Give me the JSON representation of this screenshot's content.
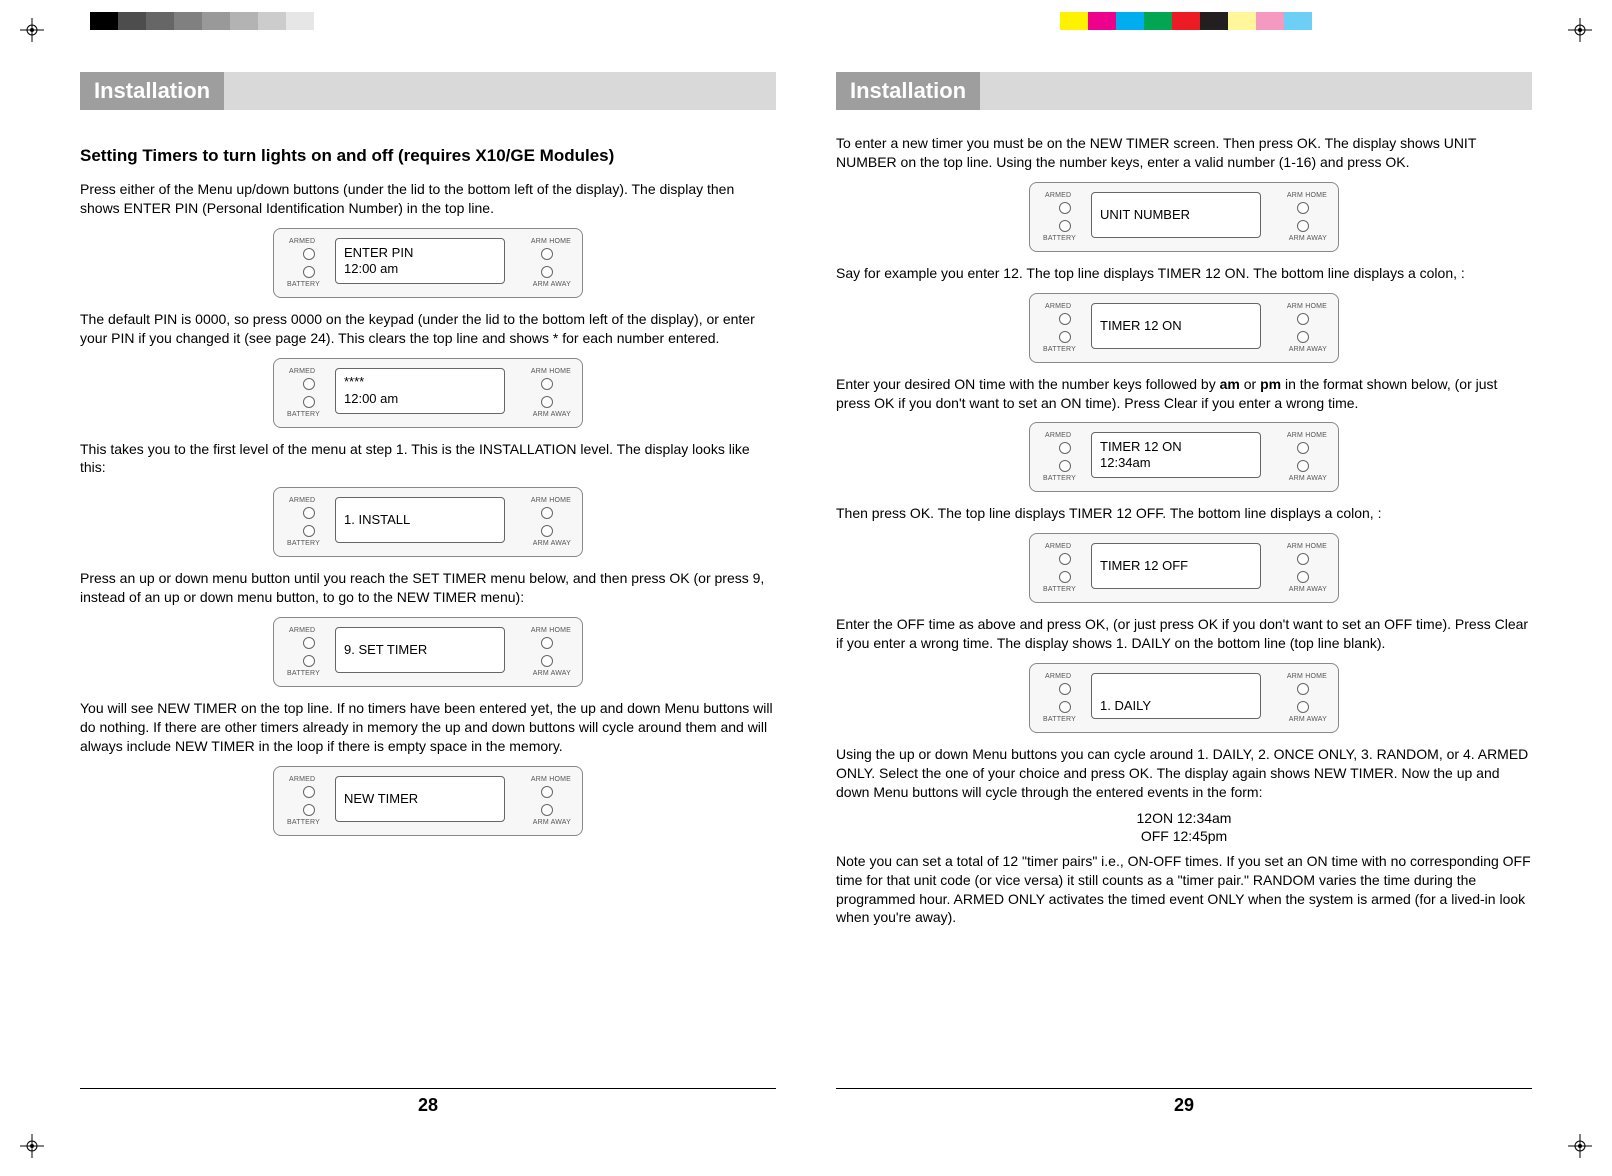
{
  "topbar_left_colors": [
    "#000000",
    "#4d4d4d",
    "#666666",
    "#808080",
    "#999999",
    "#b3b3b3",
    "#cccccc",
    "#e6e6e6",
    "#ffffff"
  ],
  "topbar_right_colors": [
    "#fff200",
    "#ec008c",
    "#00aeef",
    "#00a651",
    "#ed1c24",
    "#231f20",
    "#fff799",
    "#f49ac1",
    "#6dcff6"
  ],
  "lcd_labels": {
    "armed": "ARMED",
    "battery": "BATTERY",
    "armhome": "ARM HOME",
    "armaway": "ARM AWAY"
  },
  "left": {
    "header": "Installation",
    "subtitle": "Setting Timers to turn lights on and off (requires X10/GE Modules)",
    "p1": "Press either of the Menu up/down buttons (under the lid to the bottom left of the display). The display then shows ENTER PIN (Personal Identification Number) in the top line.",
    "lcd1_l1": "ENTER PIN",
    "lcd1_l2": "12:00 am",
    "p2": "The default PIN is 0000, so press 0000 on the keypad (under the lid to the bottom left of the display), or enter your PIN if you changed it (see page 24). This clears the top line and shows * for each number entered.",
    "lcd2_l1": "****",
    "lcd2_l2": "12:00 am",
    "p3": "This takes you to the first level of the menu at step 1. This is the INSTALLATION level. The display looks like this:",
    "lcd3_l1": "1. INSTALL",
    "p4": "Press an up or down menu button until you reach the SET TIMER menu below, and then press OK (or press 9, instead of an up or down menu button, to go to the NEW TIMER menu):",
    "lcd4_l1": "9. SET TIMER",
    "p5": "You will see NEW TIMER on the top line. If no timers have been entered yet, the up and down Menu buttons will do nothing. If there are other timers already in memory the up and down buttons will cycle around them and will always include NEW TIMER in the loop if there is empty space in the memory.",
    "lcd5_l1": "NEW TIMER",
    "page_num": "28"
  },
  "right": {
    "header": "Installation",
    "p1": "To enter a new timer you must be on the NEW TIMER screen. Then press OK. The display shows UNIT NUMBER on the top line. Using the number keys, enter a valid number (1-16) and press OK.",
    "lcd1_l1": "UNIT NUMBER",
    "p2": "Say for example you enter 12. The top line displays TIMER 12 ON. The bottom line displays a colon,  :",
    "lcd2_l1": "TIMER 12 ON",
    "p3a": "Enter your desired ON time with the number keys followed by ",
    "p3b": " or ",
    "p3c": " in the format shown below, (or just press OK if you don't want to set an ON time). Press Clear if you enter a wrong time.",
    "am": "am",
    "pm": "pm",
    "lcd3_l1": "TIMER 12 ON",
    "lcd3_l2": "12:34am",
    "p4": "Then press OK. The top line displays TIMER 12 OFF. The bottom line displays a colon,  :",
    "lcd4_l1": "TIMER 12 OFF",
    "p5": "Enter the OFF time as above and press OK, (or just press OK if you don't want to set an OFF time). Press Clear if you enter a wrong time. The display shows 1. DAILY on the bottom line (top line blank).",
    "lcd5_l2": "1. DAILY",
    "p6": "Using the up or down Menu buttons you can cycle around 1. DAILY, 2. ONCE ONLY, 3. RANDOM, or 4. ARMED ONLY. Select the one of your choice and press OK. The display again shows NEW TIMER. Now the up and down Menu buttons will cycle through the entered events in the form:",
    "events_l1": "12ON 12:34am",
    "events_l2": "OFF 12:45pm",
    "p7": "Note you can set a total of 12 \"timer pairs\" i.e., ON-OFF times. If you set an ON time with no corresponding OFF time for that unit code (or vice versa) it still counts as a \"timer pair.\" RANDOM varies the time during the programmed hour. ARMED ONLY activates the timed event ONLY when the system is armed (for a lived-in look when you're away).",
    "page_num": "29"
  }
}
